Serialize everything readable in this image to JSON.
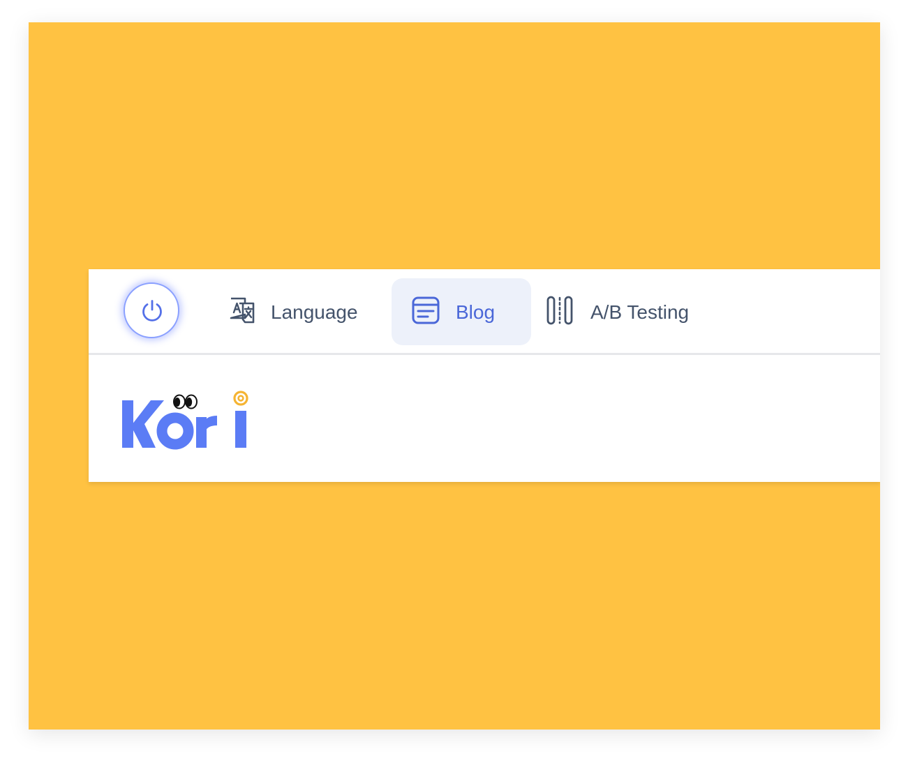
{
  "colors": {
    "background": "#FFC242",
    "accent": "#4A67D8",
    "text": "#44536B",
    "active_tab_bg": "#EDF1FA",
    "logo_blue": "#5B7CF5",
    "logo_dot": "#F5B433"
  },
  "toolbar": {
    "power_icon": "power-icon",
    "tabs": [
      {
        "label": "Language",
        "icon": "translate-icon",
        "active": false
      },
      {
        "label": "Blog",
        "icon": "document-lines-icon",
        "active": true
      },
      {
        "label": "A/B Testing",
        "icon": "ab-testing-icon",
        "active": false
      }
    ]
  },
  "content": {
    "logo_text": "Kori"
  }
}
